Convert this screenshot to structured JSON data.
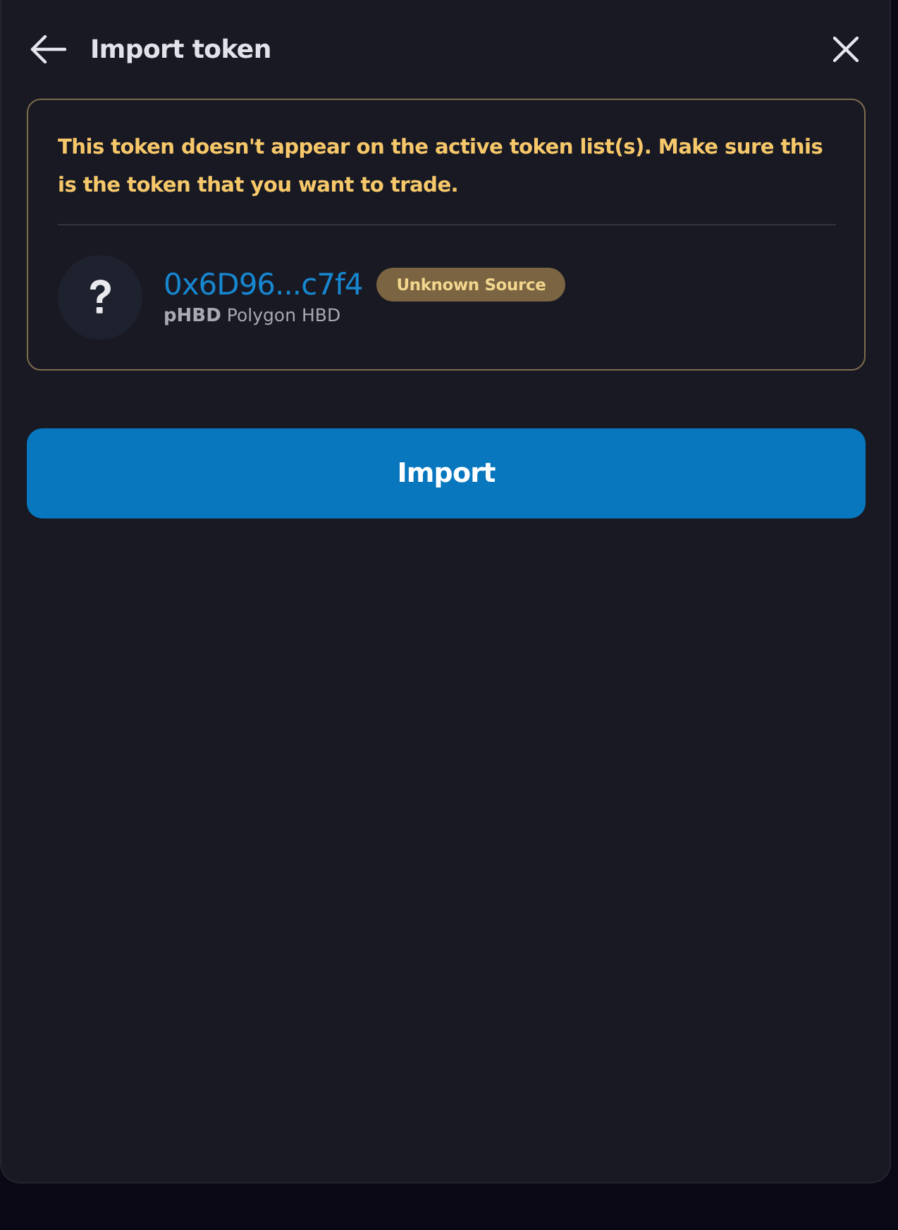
{
  "header": {
    "title": "Import token"
  },
  "warning": {
    "message": "This token doesn't appear on the active token list(s). Make sure this is the token that you want to trade."
  },
  "token": {
    "address": "0x6D96...c7f4",
    "badge": "Unknown Source",
    "symbol": "pHBD",
    "name": "Polygon HBD"
  },
  "import_button": {
    "label": "Import"
  }
}
